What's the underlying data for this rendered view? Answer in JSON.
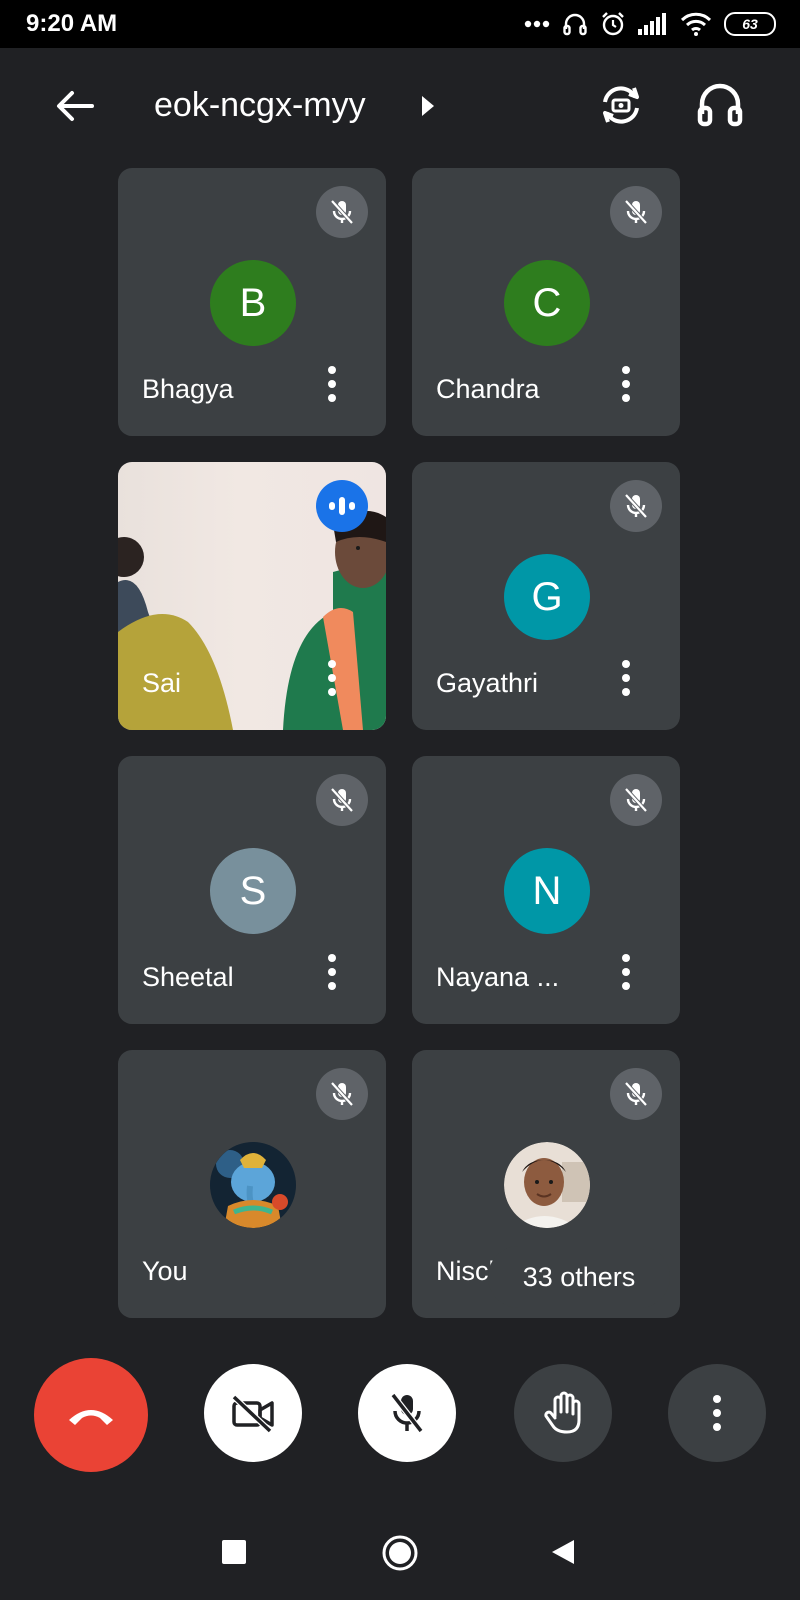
{
  "status_bar": {
    "time": "9:20 AM",
    "battery": "63"
  },
  "meeting": {
    "code": "eok-ncgx-myy"
  },
  "participants": [
    {
      "name": "Bhagya",
      "initial": "B",
      "color": "#2e7d1e",
      "muted": true
    },
    {
      "name": "Chandra",
      "initial": "C",
      "color": "#2e7d1e",
      "muted": true
    },
    {
      "name": "Sai",
      "initial": "",
      "color": "",
      "muted": false,
      "speaking": true,
      "video": true
    },
    {
      "name": "Gayathri",
      "initial": "G",
      "color": "#0097a7",
      "muted": true
    },
    {
      "name": "Sheetal",
      "initial": "S",
      "color": "#78909c",
      "muted": true
    },
    {
      "name": "Nayana ...",
      "initial": "N",
      "color": "#0097a7",
      "muted": true
    },
    {
      "name": "You",
      "initial": "",
      "color": "",
      "muted": true,
      "photo": "ganesha-avatar"
    },
    {
      "name": "Nisch",
      "initial": "",
      "color": "",
      "muted": true,
      "photo": "boy-avatar"
    }
  ],
  "others_label": "33 others",
  "controls": {
    "end_call_color": "#ea4335",
    "camera": "camera-off",
    "mic": "mic-off",
    "raise_hand": "raise-hand",
    "more": "more-options"
  }
}
